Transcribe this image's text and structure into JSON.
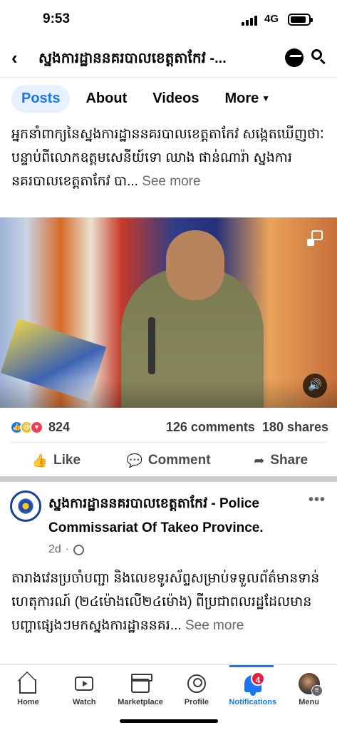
{
  "status_bar": {
    "time": "9:53",
    "network": "4G"
  },
  "header": {
    "back_icon": "chevron-left-icon",
    "title": "ស្នងការដ្ឋាននគរបាលខេត្តតាកែវ -...",
    "messenger_icon": "messenger-icon",
    "search_icon": "search-icon"
  },
  "tabs": [
    {
      "label": "Posts",
      "active": true
    },
    {
      "label": "About",
      "active": false
    },
    {
      "label": "Videos",
      "active": false
    },
    {
      "label": "More",
      "active": false
    }
  ],
  "post1": {
    "text": "អ្នកនាំពាក្យនៃស្នងការដ្ឋាននគរបាលខេត្តតាកែវ សង្កេតឃើញថាៈ បន្ទាប់ពីលោកឧត្តមសេនីយ៍ទោ ឈាង ផាន់ណារ៉ា ស្នងការនគរបាលខេត្តតាកែវ បា...",
    "see_more": "See more",
    "reaction_count": "824",
    "comments": "126 comments",
    "shares": "180 shares"
  },
  "actions": {
    "like": "Like",
    "comment": "Comment",
    "share": "Share"
  },
  "post2": {
    "author": "ស្នងការដ្ឋាននគរបាលខេត្តតាកែវ - Police Commissariat Of Takeo Province.",
    "time": "2d",
    "text": "តារាងវេនប្រចាំបញ្ជា និងលេខទូរស័ព្ទសម្រាប់ទទួលព័ត៌មានទាន់ហេតុការណ៍ (២៤ម៉ោងលើ២៤ម៉ោង) ពីប្រជាពលរដ្ឋដែលមានបញ្ហាផ្សេងៗមកស្នងការដ្ឋាននគរ...",
    "see_more": "See more",
    "more_dots": "•••"
  },
  "bottom_nav": [
    {
      "label": "Home",
      "icon": "home-icon"
    },
    {
      "label": "Watch",
      "icon": "watch-icon"
    },
    {
      "label": "Marketplace",
      "icon": "marketplace-icon"
    },
    {
      "label": "Profile",
      "icon": "profile-icon"
    },
    {
      "label": "Notifications",
      "icon": "bell-icon",
      "active": true,
      "badge": "4"
    },
    {
      "label": "Menu",
      "icon": "menu-avatar-icon"
    }
  ],
  "colors": {
    "accent": "#1877f2",
    "badge": "#e41e3f",
    "secondary_text": "#65676b"
  }
}
